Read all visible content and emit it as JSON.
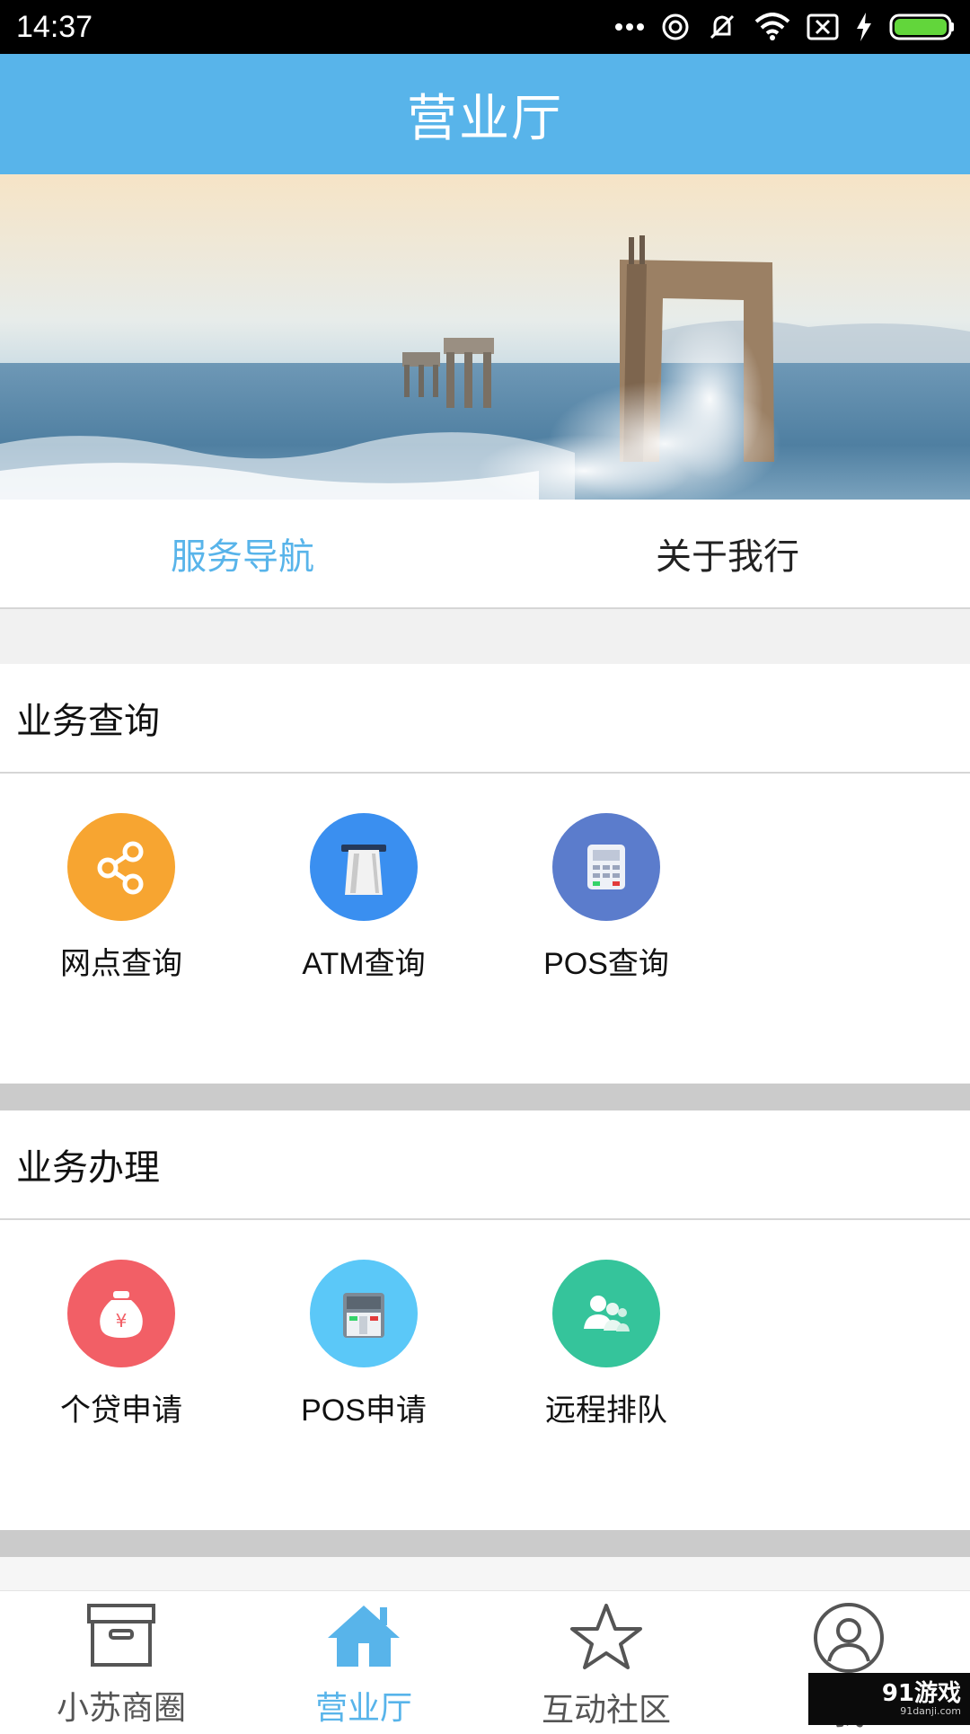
{
  "status_bar": {
    "time": "14:37",
    "icons": [
      "more-dots-icon",
      "hotspot-icon",
      "mute-icon",
      "wifi-icon",
      "no-sim-icon",
      "charging-icon",
      "battery-icon"
    ]
  },
  "app_bar": {
    "title": "营业厅"
  },
  "banner": {
    "description_icon": "sea-pier-photo"
  },
  "tabs": [
    {
      "label": "服务导航",
      "active": true
    },
    {
      "label": "关于我行",
      "active": false
    }
  ],
  "sections": {
    "query": {
      "title": "业务查询",
      "items": [
        {
          "label": "网点查询",
          "icon": "share-icon",
          "color": "#f7a531"
        },
        {
          "label": "ATM查询",
          "icon": "atm-icon",
          "color": "#3a8ff0"
        },
        {
          "label": "POS查询",
          "icon": "pos-terminal-icon",
          "color": "#5b7ccc"
        }
      ]
    },
    "handle": {
      "title": "业务办理",
      "items": [
        {
          "label": "个贷申请",
          "icon": "money-bag-icon",
          "color": "#f25f66"
        },
        {
          "label": "POS申请",
          "icon": "pos-machine-icon",
          "color": "#5bc8f8"
        },
        {
          "label": "远程排队",
          "icon": "people-queue-icon",
          "color": "#35c49b"
        }
      ]
    }
  },
  "bottom_nav": [
    {
      "label": "小苏商圈",
      "icon": "box-icon",
      "active": false
    },
    {
      "label": "营业厅",
      "icon": "home-icon",
      "active": true
    },
    {
      "label": "互动社区",
      "icon": "star-icon",
      "active": false
    },
    {
      "label": "我",
      "icon": "user-icon",
      "active": false
    }
  ],
  "watermark": {
    "main": "91游戏",
    "sub": "91danji.com"
  },
  "colors": {
    "primary": "#58b4ea",
    "divider": "#cbcbcb"
  }
}
